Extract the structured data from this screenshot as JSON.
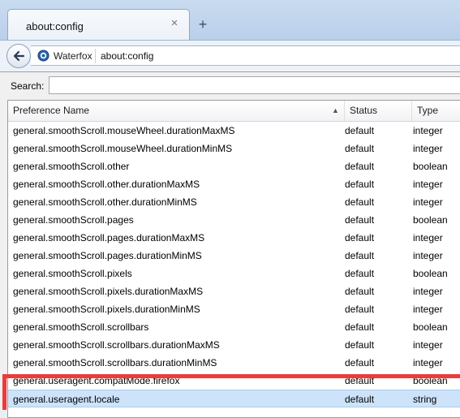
{
  "tab": {
    "title": "about:config",
    "close_glyph": "×",
    "new_tab_glyph": "+"
  },
  "nav": {
    "site_name": "Waterfox",
    "url": "about:config"
  },
  "search": {
    "label": "Search:",
    "value": "",
    "placeholder": ""
  },
  "table": {
    "headers": {
      "name": "Preference Name",
      "status": "Status",
      "type": "Type"
    },
    "rows": [
      {
        "name": "general.smoothScroll.mouseWheel.durationMaxMS",
        "status": "default",
        "type": "integer"
      },
      {
        "name": "general.smoothScroll.mouseWheel.durationMinMS",
        "status": "default",
        "type": "integer"
      },
      {
        "name": "general.smoothScroll.other",
        "status": "default",
        "type": "boolean"
      },
      {
        "name": "general.smoothScroll.other.durationMaxMS",
        "status": "default",
        "type": "integer"
      },
      {
        "name": "general.smoothScroll.other.durationMinMS",
        "status": "default",
        "type": "integer"
      },
      {
        "name": "general.smoothScroll.pages",
        "status": "default",
        "type": "boolean"
      },
      {
        "name": "general.smoothScroll.pages.durationMaxMS",
        "status": "default",
        "type": "integer"
      },
      {
        "name": "general.smoothScroll.pages.durationMinMS",
        "status": "default",
        "type": "integer"
      },
      {
        "name": "general.smoothScroll.pixels",
        "status": "default",
        "type": "boolean"
      },
      {
        "name": "general.smoothScroll.pixels.durationMaxMS",
        "status": "default",
        "type": "integer"
      },
      {
        "name": "general.smoothScroll.pixels.durationMinMS",
        "status": "default",
        "type": "integer"
      },
      {
        "name": "general.smoothScroll.scrollbars",
        "status": "default",
        "type": "boolean"
      },
      {
        "name": "general.smoothScroll.scrollbars.durationMaxMS",
        "status": "default",
        "type": "integer"
      },
      {
        "name": "general.smoothScroll.scrollbars.durationMinMS",
        "status": "default",
        "type": "integer"
      },
      {
        "name": "general.useragent.compatMode.firefox",
        "status": "default",
        "type": "boolean"
      },
      {
        "name": "general.useragent.locale",
        "status": "default",
        "type": "string"
      }
    ]
  },
  "colors": {
    "highlight": "#ee3a3a",
    "selected_row": "#cde3f9"
  }
}
